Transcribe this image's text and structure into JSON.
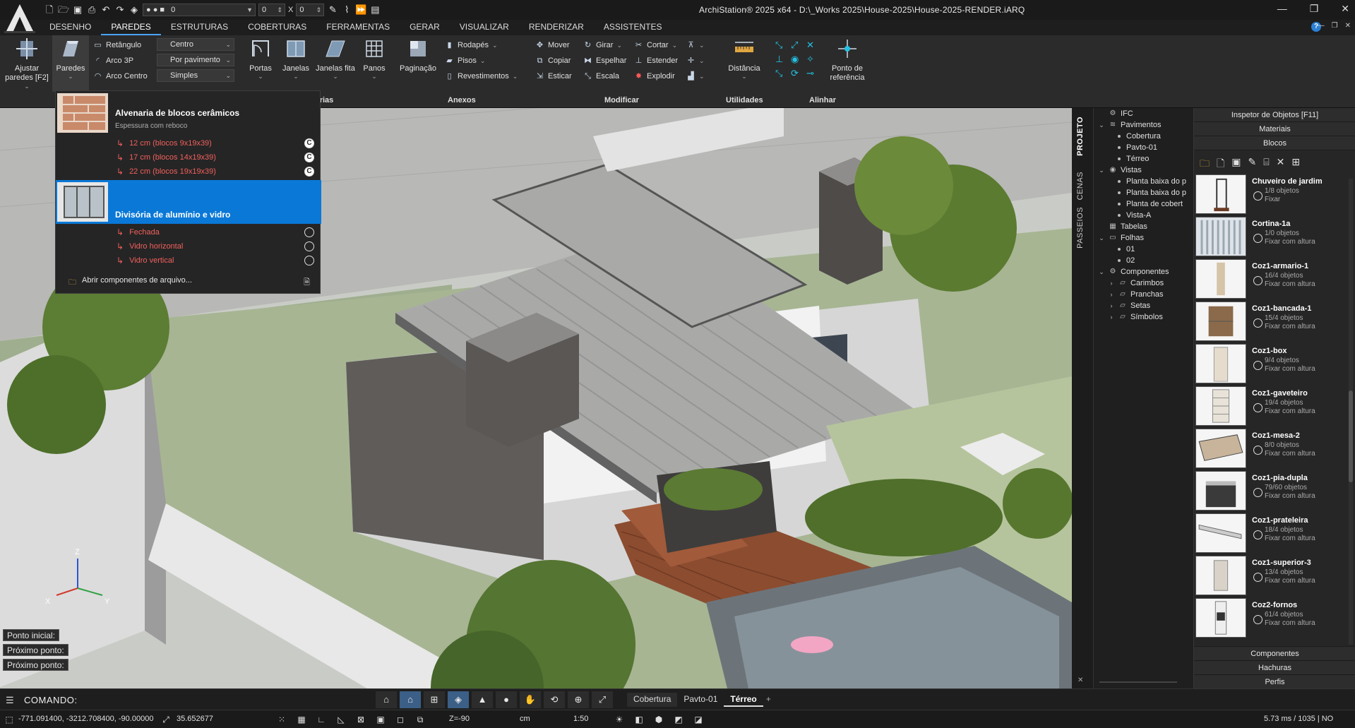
{
  "app": {
    "title": "ArchiStation® 2025 x64 - D:\\_Works 2025\\House-2025\\House-2025-RENDER.iARQ",
    "layer_value": "0",
    "x_value": "0",
    "x_label": "X",
    "y_value": "0"
  },
  "menu": {
    "tabs": [
      "DESENHO",
      "PAREDES",
      "ESTRUTURAS",
      "COBERTURAS",
      "FERRAMENTAS",
      "GERAR",
      "VISUALIZAR",
      "RENDERIZAR",
      "ASSISTENTES"
    ],
    "active": "PAREDES"
  },
  "ribbon": {
    "ajustar": "Ajustar paredes [F2]",
    "paredes": "Paredes",
    "retangulo": "Retângulo",
    "arco3p": "Arco 3P",
    "arcocentro": "Arco Centro",
    "centro": "Centro",
    "porpavimento": "Por pavimento",
    "simples": "Simples",
    "portas": "Portas",
    "janelas": "Janelas",
    "janelasfita": "Janelas fita",
    "panos": "Panos",
    "paginacao": "Paginação",
    "rodapes": "Rodapés",
    "pisos": "Pisos",
    "revestimentos": "Revestimentos",
    "mover": "Mover",
    "copiar": "Copiar",
    "esticar": "Esticar",
    "girar": "Girar",
    "espelhar": "Espelhar",
    "escala": "Escala",
    "cortar": "Cortar",
    "estender": "Estender",
    "explodir": "Explodir",
    "distancia": "Distância",
    "ponto_referencia": "Ponto de referência",
    "groups": {
      "esquadrias": "drias",
      "anexos": "Anexos",
      "modificar": "Modificar",
      "utilidades": "Utilidades",
      "alinhar": "Alinhar"
    }
  },
  "flyout": {
    "group1": {
      "title": "Alvenaria de blocos cerâmicos",
      "subtitle": "Espessura com reboco",
      "items": [
        "12 cm (blocos 9x19x39)",
        "17 cm (blocos 14x19x39)",
        "22 cm (blocos 19x19x39)"
      ],
      "marker": "C"
    },
    "group2": {
      "title": "Divisória de alumínio e vidro",
      "items": [
        "Fechada",
        "Vidro horizontal",
        "Vidro vertical"
      ]
    },
    "open_label": "Abrir componentes de arquivo..."
  },
  "prompts": [
    "Ponto inicial:",
    "Próximo ponto:",
    "Próximo ponto:"
  ],
  "axes": {
    "z": "Z",
    "x": "X",
    "y": "Y"
  },
  "side_tabs": [
    "PROJETO",
    "CENAS",
    "PASSEIOS"
  ],
  "tree": {
    "ifc": "IFC",
    "pavimentos": "Pavimentos",
    "pav_items": [
      "Cobertura",
      "Pavto-01",
      "Térreo"
    ],
    "vistas": "Vistas",
    "vista_items": [
      "Planta baixa do p",
      "Planta baixa do p",
      "Planta de cobert",
      "Vista-A"
    ],
    "tabelas": "Tabelas",
    "folhas": "Folhas",
    "folha_items": [
      "01",
      "02"
    ],
    "componentes": "Componentes",
    "comp_items": [
      "Carimbos",
      "Pranchas",
      "Setas",
      "Símbolos"
    ]
  },
  "inspector": {
    "header": "Inspetor de Objetos [F11]",
    "materiais": "Materiais",
    "blocos": "Blocos",
    "blocks": [
      {
        "name": "Chuveiro de jardim",
        "count": "1/8 objetos",
        "fix": "Fixar"
      },
      {
        "name": "Cortina-1a",
        "count": "1/0 objetos",
        "fix": "Fixar com altura"
      },
      {
        "name": "Coz1-armario-1",
        "count": "16/4 objetos",
        "fix": "Fixar com altura"
      },
      {
        "name": "Coz1-bancada-1",
        "count": "15/4 objetos",
        "fix": "Fixar com altura"
      },
      {
        "name": "Coz1-box",
        "count": "9/4 objetos",
        "fix": "Fixar com altura"
      },
      {
        "name": "Coz1-gaveteiro",
        "count": "19/4 objetos",
        "fix": "Fixar com altura"
      },
      {
        "name": "Coz1-mesa-2",
        "count": "8/0 objetos",
        "fix": "Fixar com altura"
      },
      {
        "name": "Coz1-pia-dupla",
        "count": "79/60 objetos",
        "fix": "Fixar com altura"
      },
      {
        "name": "Coz1-prateleira",
        "count": "18/4 objetos",
        "fix": "Fixar com altura"
      },
      {
        "name": "Coz1-superior-3",
        "count": "13/4 objetos",
        "fix": "Fixar com altura"
      },
      {
        "name": "Coz2-fornos",
        "count": "61/4 objetos",
        "fix": "Fixar com altura"
      }
    ],
    "footer": [
      "Componentes",
      "Hachuras",
      "Perfis"
    ]
  },
  "command": {
    "label": "COMANDO:",
    "layout_tabs": [
      "Cobertura",
      "Pavto-01",
      "Térreo"
    ],
    "active_tab": "Térreo"
  },
  "status": {
    "coords": "-771.091400, -3212.708400, -90.00000",
    "distance": "35.652677",
    "z": "Z=-90",
    "unit": "cm",
    "scale": "1:50",
    "perf": "5.73 ms / 1035 | NO"
  },
  "colors": {
    "accent": "#0a78d7",
    "red_item": "#f0605a",
    "ribbon_bg": "#2b2b2b"
  }
}
